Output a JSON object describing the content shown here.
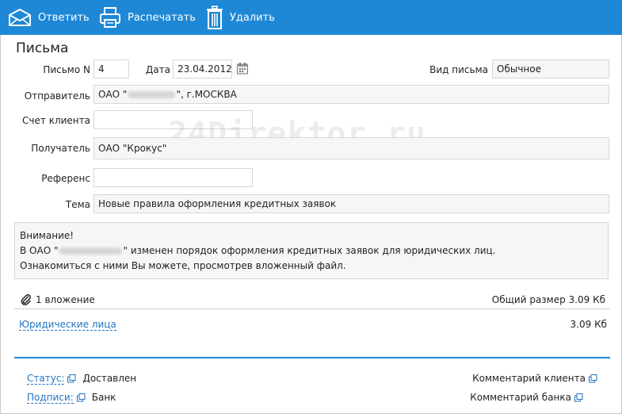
{
  "toolbar": {
    "reply_label": "Ответить",
    "print_label": "Распечатать",
    "delete_label": "Удалить"
  },
  "page_title": "Письма",
  "form": {
    "letter_no_label": "Письмо N",
    "letter_no_value": "4",
    "date_label": "Дата",
    "date_value": "23.04.2012",
    "type_label": "Вид письма",
    "type_value": "Обычное",
    "sender_label": "Отправитель",
    "sender_prefix": "ОАО \"",
    "sender_suffix": "\", г.МОСКВА",
    "client_account_label": "Счет клиента",
    "client_account_value": "",
    "recipient_label": "Получатель",
    "recipient_value": "ОАО \"Крокус\"",
    "reference_label": "Референс",
    "reference_value": "",
    "subject_label": "Тема",
    "subject_value": "Новые правила оформления кредитных заявок"
  },
  "watermark": "24Direktor.ru",
  "message": {
    "line1": "Внимание!",
    "line2_prefix": "В ОАО \"",
    "line2_suffix": "\" изменен порядок оформления кредитных заявок для юридических лиц.",
    "line3": "Ознакомиться с ними  Вы можете, просмотрев вложенный файл."
  },
  "attachments": {
    "count_label": "1 вложение",
    "total_size_label": "Общий размер 3.09 Кб",
    "files": [
      {
        "name": "Юридические лица",
        "size": "3.09 Кб"
      }
    ]
  },
  "footer": {
    "status_label": "Статус:",
    "status_value": "Доставлен",
    "signatures_label": "Подписи:",
    "signatures_value": "Банк",
    "client_comment_label": "Комментарий клиента",
    "bank_comment_label": "Комментарий банка"
  },
  "colors": {
    "toolbar_bg": "#1e88d6",
    "link": "#1f73c2",
    "field_bg": "#f6f6f6"
  }
}
